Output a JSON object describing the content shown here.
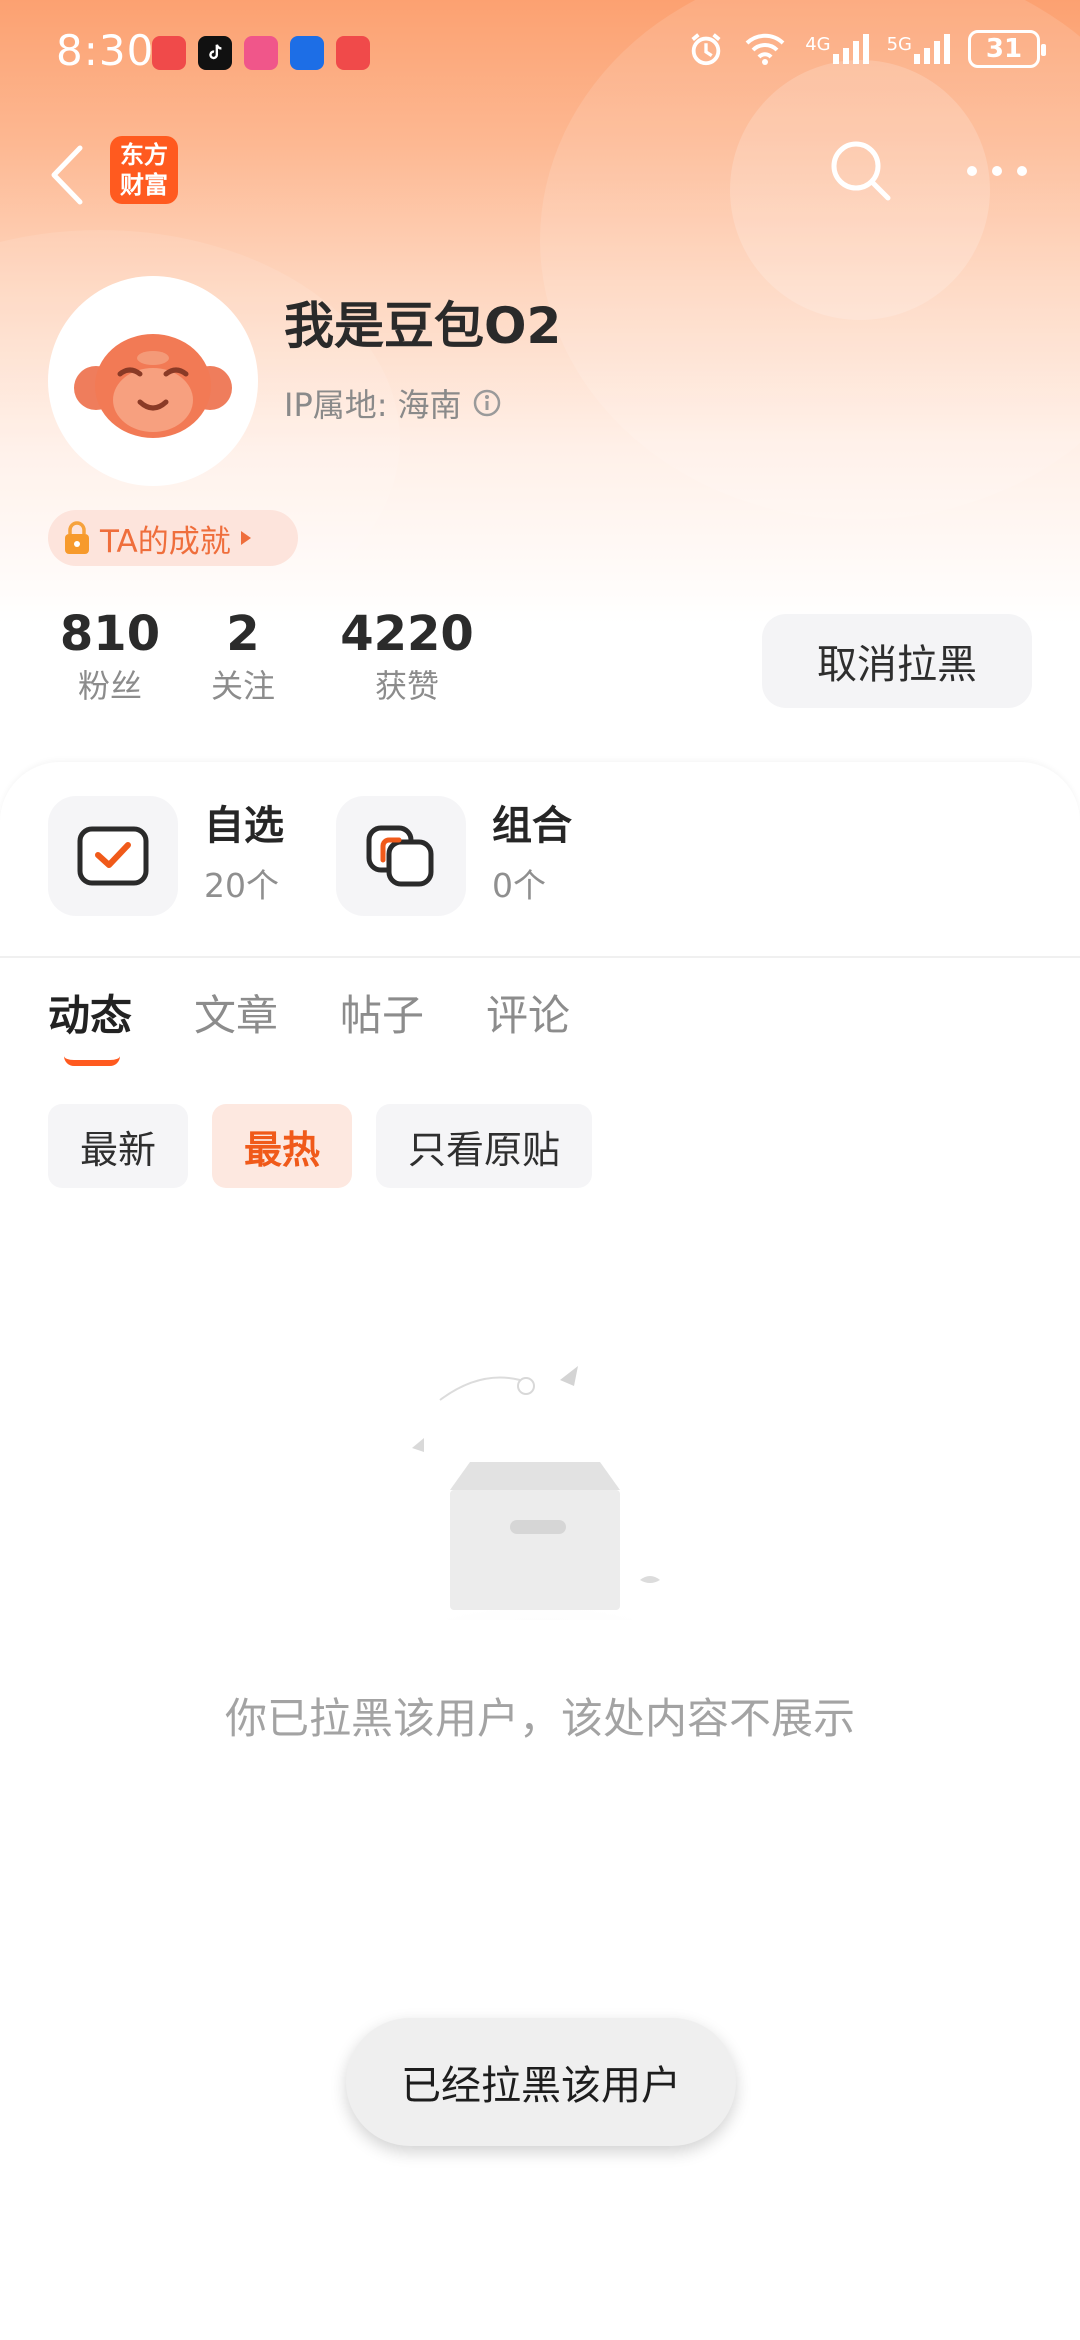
{
  "status_bar": {
    "time": "8:30",
    "battery": "31",
    "app_icons": [
      "huawei-app-icon",
      "tiktok-icon",
      "app-icon",
      "12123-icon",
      "huawei-app-icon"
    ],
    "signal_labels": [
      "4G",
      "5G"
    ]
  },
  "nav": {
    "logo_line1": "东方",
    "logo_line2": "财富"
  },
  "profile": {
    "username": "我是豆包O2",
    "ip_label": "IP属地:",
    "ip_location": "海南",
    "achievement": "TA的成就"
  },
  "stats": [
    {
      "value": "810",
      "label": "粉丝"
    },
    {
      "value": "2",
      "label": "关注"
    },
    {
      "value": "4220",
      "label": "获赞"
    }
  ],
  "unblock_button": "取消拉黑",
  "quick_links": [
    {
      "title": "自选",
      "subtitle": "20个"
    },
    {
      "title": "组合",
      "subtitle": "0个"
    }
  ],
  "tabs": [
    {
      "label": "动态",
      "active": true
    },
    {
      "label": "文章",
      "active": false
    },
    {
      "label": "帖子",
      "active": false
    },
    {
      "label": "评论",
      "active": false
    }
  ],
  "filters": [
    {
      "label": "最新",
      "active": false
    },
    {
      "label": "最热",
      "active": true
    },
    {
      "label": "只看原贴",
      "active": false
    }
  ],
  "empty_message": "你已拉黑该用户，该处内容不展示",
  "toast": "已经拉黑该用户",
  "colors": {
    "accent": "#ff5a1f",
    "hero_top": "#fca171",
    "chip_active_bg": "#fde8e0"
  }
}
